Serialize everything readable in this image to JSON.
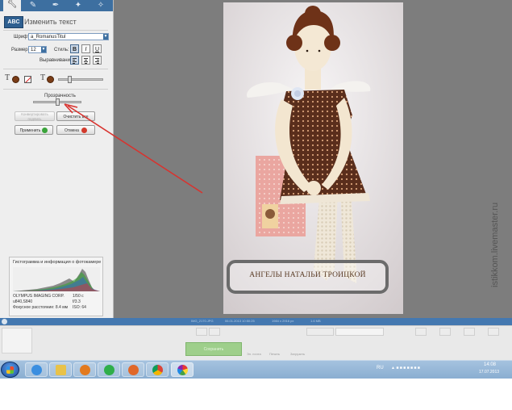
{
  "panel": {
    "title": "Изменить текст",
    "font_label": "Шрифт:",
    "font_value": "a_RomanusTitul",
    "size_label": "Размер:",
    "size_value": "12",
    "style_label": "Стиль:",
    "bold": "B",
    "italic": "I",
    "underline": "U",
    "align_label": "Выравнивание:",
    "text_glyph": "T",
    "opacity_label": "Прозрачность",
    "opacity_value": 0.5,
    "btn_convert": "Конвертировать подпись",
    "btn_clear": "Очистить все",
    "btn_apply": "Применить",
    "btn_cancel": "Отмена"
  },
  "histogram": {
    "title": "Гистограмма и информация о фотокамере",
    "camera": "OLYMPUS IMAGING CORP.",
    "model": "u840,S840",
    "focal": "Фокусное расстояние: 8.4 мм",
    "shutter": "1/50 с",
    "aperture": "f/3.3",
    "iso": "ISO: 64"
  },
  "photo": {
    "caption": "АНГЕЛЫ НАТАЛЬИ ТРОИЦКОЙ"
  },
  "statusbar": {
    "items": [
      "IMG_2170.JPG",
      "06.01.2013 10:50:25",
      "1984 x 2916 px",
      "1.6 MB"
    ]
  },
  "bottom": {
    "email": "Эл. почта",
    "print": "Печать",
    "upload": "Загрузить",
    "save": "Сохранить"
  },
  "taskbar": {
    "lang": "RU",
    "time": "14:08",
    "date": "17.07.2013"
  },
  "watermark": "istikkom.livemaster.ru",
  "colors": {
    "accent_blue": "#3d6fa0",
    "annotation_red": "#d8332f",
    "text_color": "#7a3d17"
  },
  "icons": {
    "tool_tabs": [
      "wrench-icon",
      "brush-icon",
      "pencil-icon",
      "magic-icon",
      "sparkle-icon"
    ]
  }
}
